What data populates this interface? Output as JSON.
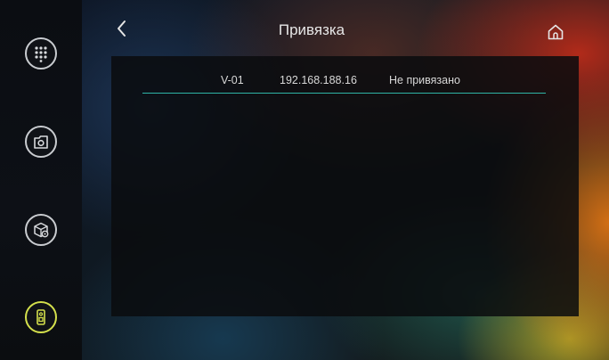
{
  "header": {
    "title": "Привязка",
    "back_icon": "chevron-left-icon",
    "home_icon": "home-icon"
  },
  "sidebar": {
    "items": [
      {
        "icon": "keypad-icon"
      },
      {
        "icon": "camera-folder-icon"
      },
      {
        "icon": "settings-box-icon"
      },
      {
        "icon": "intercom-device-icon",
        "active": true
      }
    ]
  },
  "devices": [
    {
      "name": "V-01",
      "ip": "192.168.188.16",
      "status": "Не привязано"
    }
  ],
  "colors": {
    "accent_line": "#2fb4a6",
    "active_outline": "#d4e04c",
    "icon_outline": "#c9ccd0"
  }
}
